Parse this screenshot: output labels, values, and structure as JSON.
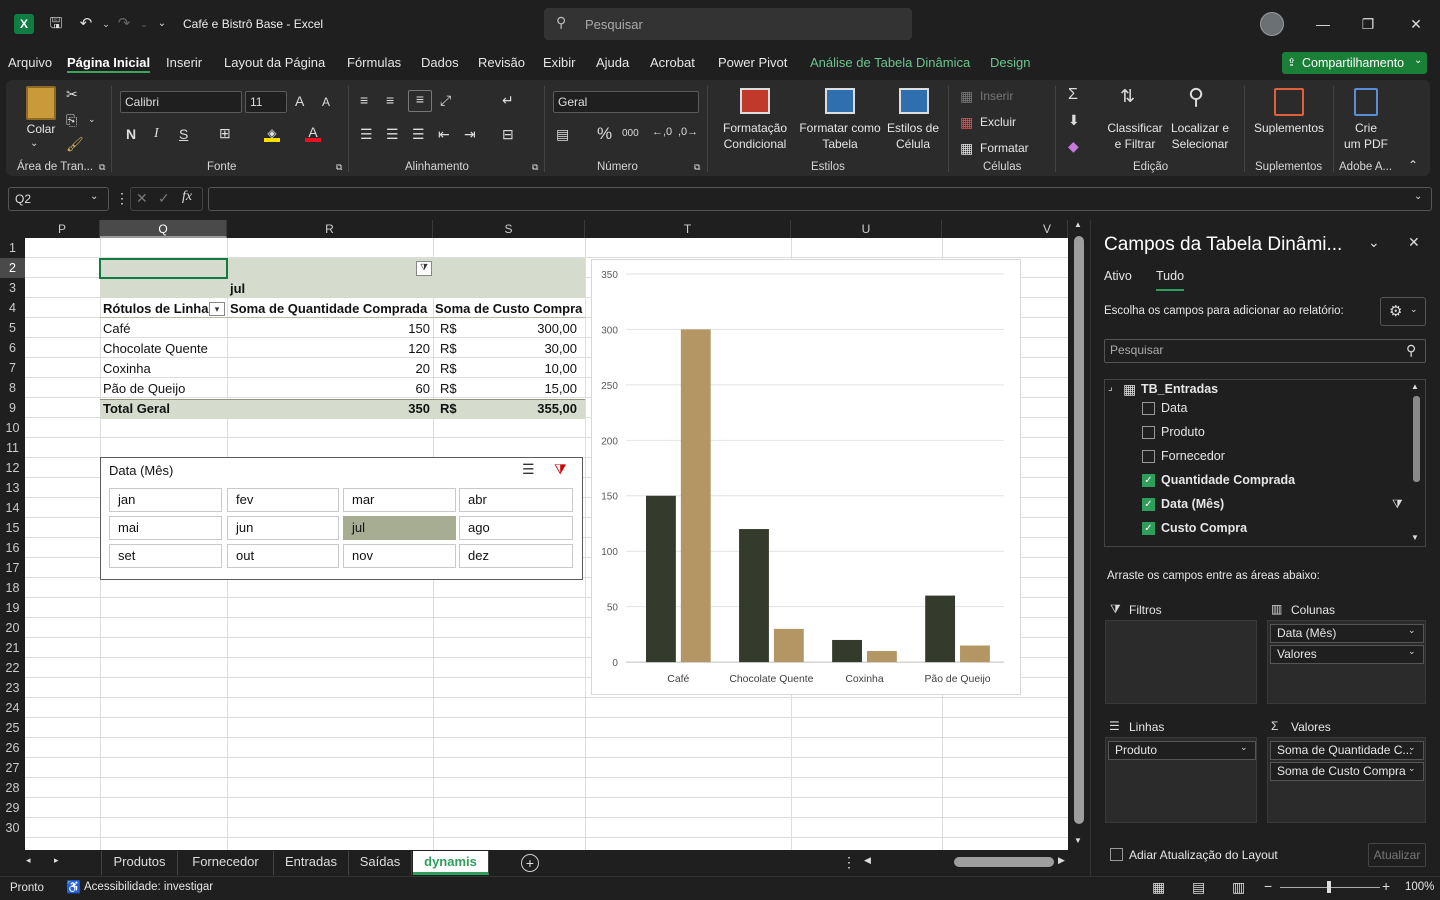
{
  "title": {
    "doc": "Café e Bistrô Base  -  Excel",
    "search_placeholder": "Pesquisar",
    "close": "✕",
    "minimize": "—",
    "restore": "❐"
  },
  "menu": {
    "items": [
      "Arquivo",
      "Página Inicial",
      "Inserir",
      "Layout da Página",
      "Fórmulas",
      "Dados",
      "Revisão",
      "Exibir",
      "Ajuda",
      "Acrobat",
      "Power Pivot",
      "Análise de Tabela Dinâmica",
      "Design"
    ],
    "share": "Compartilhamento"
  },
  "ribbon": {
    "clipboard": {
      "paste": "Colar",
      "group": "Área de Tran..."
    },
    "font": {
      "name": "Calibri",
      "size": "11",
      "bold": "N",
      "italic": "I",
      "underline": "S",
      "grow": "A",
      "shrink": "A",
      "group": "Fonte"
    },
    "alignment": {
      "group": "Alinhamento"
    },
    "number": {
      "format": "Geral",
      "percent": "%",
      "thousands": "000",
      "group": "Número"
    },
    "styles": {
      "cond1": "Formatação",
      "cond2": "Condicional",
      "table1": "Formatar como",
      "table2": "Tabela",
      "cell1": "Estilos de",
      "cell2": "Célula",
      "group": "Estilos"
    },
    "cells": {
      "insert": "Inserir",
      "delete": "Excluir",
      "format": "Formatar",
      "group": "Células"
    },
    "editing": {
      "sort1": "Classificar",
      "sort2": "e Filtrar",
      "find1": "Localizar e",
      "find2": "Selecionar",
      "group": "Edição"
    },
    "addins": {
      "label": "Suplementos",
      "group": "Suplementos"
    },
    "adobe": {
      "label1": "Crie",
      "label2": "um PDF",
      "group": "Adobe A..."
    }
  },
  "formula": {
    "namebox": "Q2",
    "fx": "fx"
  },
  "columns": [
    "P",
    "Q",
    "R",
    "S",
    "T",
    "U",
    "V"
  ],
  "rows": [
    "1",
    "2",
    "3",
    "4",
    "5",
    "6",
    "7",
    "8",
    "9",
    "10",
    "11",
    "12",
    "13",
    "14",
    "15",
    "16",
    "17",
    "18",
    "19",
    "20",
    "21",
    "22",
    "23",
    "24",
    "25",
    "26",
    "27",
    "28",
    "29",
    "30"
  ],
  "pivot": {
    "col_label": "jul",
    "h1": "Rótulos de Linha",
    "h2": "Soma de Quantidade Comprada",
    "h3": "Soma de Custo Compra",
    "rows": [
      {
        "name": "Café",
        "qty": "150",
        "cur": "R$",
        "cost": "300,00"
      },
      {
        "name": "Chocolate Quente",
        "qty": "120",
        "cur": "R$",
        "cost": "30,00"
      },
      {
        "name": "Coxinha",
        "qty": "20",
        "cur": "R$",
        "cost": "10,00"
      },
      {
        "name": "Pão de Queijo",
        "qty": "60",
        "cur": "R$",
        "cost": "15,00"
      }
    ],
    "total": {
      "name": "Total Geral",
      "qty": "350",
      "cur": "R$",
      "cost": "355,00"
    }
  },
  "slicer": {
    "title": "Data (Mês)",
    "months": [
      "jan",
      "fev",
      "mar",
      "abr",
      "mai",
      "jun",
      "jul",
      "ago",
      "set",
      "out",
      "nov",
      "dez"
    ],
    "selected": "jul"
  },
  "chart_data": {
    "type": "bar",
    "categories": [
      "Café",
      "Chocolate Quente",
      "Coxinha",
      "Pão de Queijo"
    ],
    "series": [
      {
        "name": "Soma de Quantidade Comprada",
        "values": [
          150,
          120,
          20,
          60
        ],
        "color": "#353b2c"
      },
      {
        "name": "Soma de Custo Compra",
        "values": [
          300,
          30,
          10,
          15
        ],
        "color": "#b39664"
      }
    ],
    "ylim": [
      0,
      350
    ],
    "yticks": [
      "0",
      "50",
      "100",
      "150",
      "200",
      "250",
      "300",
      "350"
    ],
    "grid": true
  },
  "tabs": {
    "items": [
      "Produtos",
      "Fornecedor",
      "Entradas",
      "Saídas",
      "dynamis"
    ],
    "active": "dynamis"
  },
  "status": {
    "ready": "Pronto",
    "accessibility": "Acessibilidade: investigar",
    "zoom": "100%"
  },
  "pane": {
    "title": "Campos da Tabela Dinâmi...",
    "tab_active": "Ativo",
    "tab_all": "Tudo",
    "choose": "Escolha os campos para adicionar ao relatório:",
    "search_placeholder": "Pesquisar",
    "table": "TB_Entradas",
    "fields": [
      {
        "name": "Data",
        "checked": false
      },
      {
        "name": "Produto",
        "checked": false
      },
      {
        "name": "Fornecedor",
        "checked": false
      },
      {
        "name": "Quantidade Comprada",
        "checked": true
      },
      {
        "name": "Data (Mês)",
        "checked": true
      },
      {
        "name": "Custo Compra",
        "checked": true
      }
    ],
    "drag": "Arraste os campos entre as áreas abaixo:",
    "filters": "Filtros",
    "columns": "Colunas",
    "rows": "Linhas",
    "values": "Valores",
    "col_items": [
      "Data (Mês)",
      "Valores"
    ],
    "row_items": [
      "Produto"
    ],
    "val_items": [
      "Soma de Quantidade C...",
      "Soma de Custo Compra"
    ],
    "defer": "Adiar Atualização do Layout",
    "update": "Atualizar"
  }
}
